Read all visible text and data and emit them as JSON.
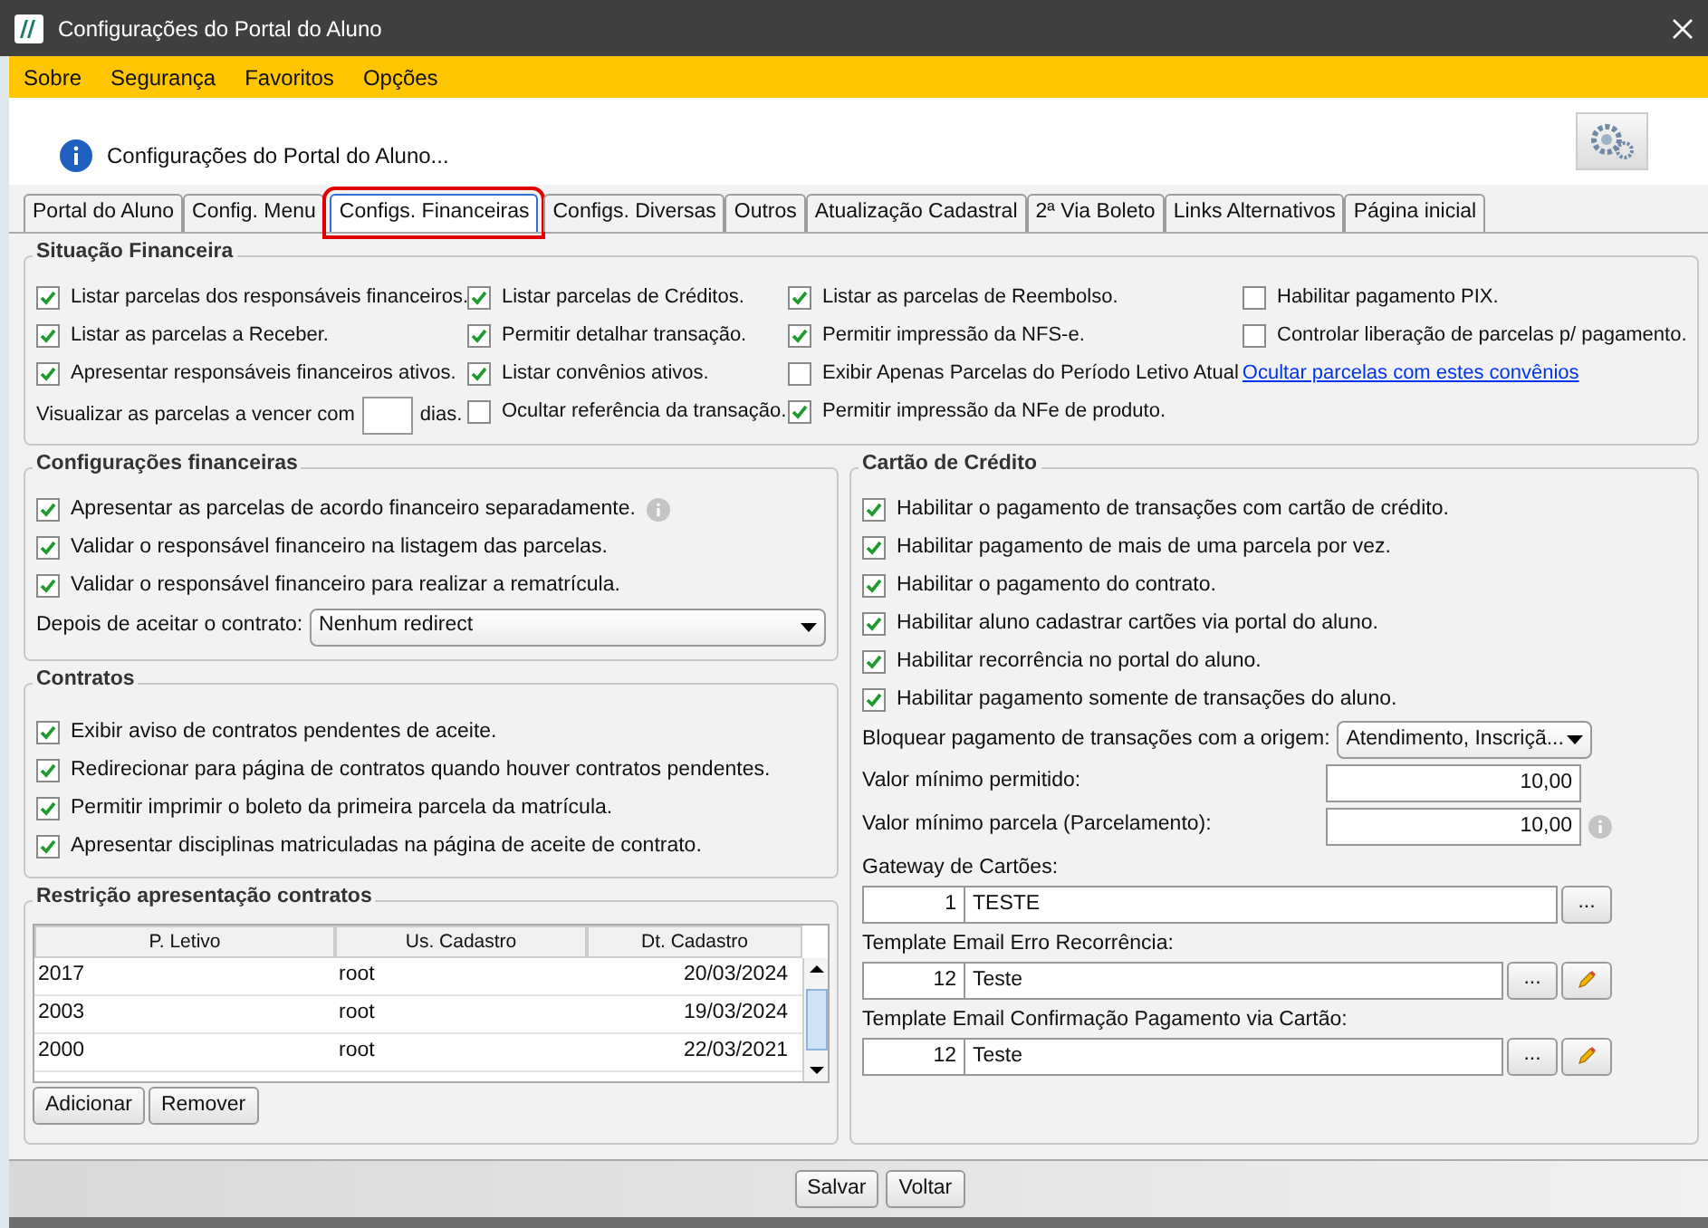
{
  "window": {
    "title": "Configurações do Portal do Aluno"
  },
  "menu": [
    "Sobre",
    "Segurança",
    "Favoritos",
    "Opções"
  ],
  "header": {
    "text": "Configurações do Portal do Aluno..."
  },
  "tabs": [
    {
      "label": "Portal do Aluno",
      "selected": false
    },
    {
      "label": "Config. Menu",
      "selected": false
    },
    {
      "label": "Configs. Financeiras",
      "selected": true,
      "highlighted": true
    },
    {
      "label": "Configs. Diversas",
      "selected": false
    },
    {
      "label": "Outros",
      "selected": false
    },
    {
      "label": "Atualização Cadastral",
      "selected": false
    },
    {
      "label": "2ª Via Boleto",
      "selected": false
    },
    {
      "label": "Links Alternativos",
      "selected": false
    },
    {
      "label": "Página inicial",
      "selected": false
    }
  ],
  "situacao": {
    "title": "Situação Financeira",
    "columns": [
      [
        {
          "kind": "checkbox",
          "label": "Listar parcelas dos responsáveis financeiros.",
          "checked": true
        },
        {
          "kind": "checkbox",
          "label": "Listar as parcelas a Receber.",
          "checked": true
        },
        {
          "kind": "checkbox",
          "label": "Apresentar responsáveis financeiros ativos.",
          "checked": true
        },
        {
          "kind": "days",
          "label": "Visualizar as parcelas a vencer com",
          "suffix": "dias."
        }
      ],
      [
        {
          "kind": "checkbox",
          "label": "Listar parcelas de Créditos.",
          "checked": true
        },
        {
          "kind": "checkbox",
          "label": "Permitir detalhar transação.",
          "checked": true
        },
        {
          "kind": "checkbox",
          "label": "Listar convênios ativos.",
          "checked": true
        },
        {
          "kind": "checkbox",
          "label": "Ocultar referência da transação.",
          "checked": false
        }
      ],
      [
        {
          "kind": "checkbox",
          "label": "Listar as parcelas de Reembolso.",
          "checked": true
        },
        {
          "kind": "checkbox",
          "label": "Permitir impressão da NFS-e.",
          "checked": true
        },
        {
          "kind": "checkbox",
          "label": "Exibir Apenas Parcelas do Período Letivo Atual",
          "checked": false,
          "link": "Ocultar parcelas com estes convênios"
        },
        {
          "kind": "checkbox",
          "label": "Permitir impressão da NFe de produto.",
          "checked": true
        }
      ],
      [
        {
          "kind": "checkbox",
          "label": "Habilitar pagamento PIX.",
          "checked": false
        },
        {
          "kind": "checkbox",
          "label": "Controlar liberação de parcelas p/ pagamento.",
          "checked": false
        }
      ]
    ]
  },
  "config_financeiras": {
    "title": "Configurações financeiras",
    "items": [
      {
        "label": "Apresentar as parcelas de acordo financeiro separadamente.",
        "checked": true,
        "info": true
      },
      {
        "label": "Validar o responsável financeiro na listagem das parcelas.",
        "checked": true,
        "info": false
      },
      {
        "label": "Validar o responsável financeiro para realizar a rematrícula.",
        "checked": true,
        "info": false
      }
    ],
    "redirect": {
      "label": "Depois de aceitar o contrato:",
      "value": "Nenhum redirect"
    }
  },
  "contratos": {
    "title": "Contratos",
    "items": [
      {
        "label": "Exibir aviso de contratos pendentes de aceite.",
        "checked": true
      },
      {
        "label": "Redirecionar para página de contratos quando houver contratos pendentes.",
        "checked": true
      },
      {
        "label": "Permitir imprimir o boleto da primeira parcela da matrícula.",
        "checked": true
      },
      {
        "label": "Apresentar disciplinas matriculadas na página de aceite de contrato.",
        "checked": true
      }
    ]
  },
  "restricao": {
    "title": "Restrição apresentação contratos",
    "columns": [
      "P. Letivo",
      "Us. Cadastro",
      "Dt. Cadastro"
    ],
    "rows": [
      [
        "2017",
        "root",
        "20/03/2024"
      ],
      [
        "2003",
        "root",
        "19/03/2024"
      ],
      [
        "2000",
        "root",
        "22/03/2021"
      ]
    ],
    "buttons": [
      "Adicionar",
      "Remover"
    ]
  },
  "cartao": {
    "title": "Cartão de Crédito",
    "items": [
      {
        "label": "Habilitar o pagamento de transações com cartão de crédito.",
        "checked": true
      },
      {
        "label": "Habilitar pagamento de mais de uma parcela por vez.",
        "checked": true
      },
      {
        "label": "Habilitar o pagamento do contrato.",
        "checked": true
      },
      {
        "label": "Habilitar aluno cadastrar cartões via portal do aluno.",
        "checked": true
      },
      {
        "label": "Habilitar recorrência no portal do aluno.",
        "checked": true
      },
      {
        "label": "Habilitar pagamento somente de transações do aluno.",
        "checked": true
      }
    ],
    "origem": {
      "label": "Bloquear pagamento de transações com a origem:",
      "value": "Atendimento, Inscriçã..."
    },
    "fields": [
      {
        "label": "Valor mínimo permitido:",
        "value": "10,00",
        "info": false
      },
      {
        "label": "Valor mínimo parcela (Parcelamento):",
        "value": "10,00",
        "info": true
      }
    ],
    "lookups": [
      {
        "label": "Gateway de Cartões:",
        "code": "1",
        "name": "TESTE",
        "browse": "...",
        "edit": false
      },
      {
        "label": "Template Email Erro Recorrência:",
        "code": "12",
        "name": "Teste",
        "browse": "...",
        "edit": true
      },
      {
        "label": "Template Email Confirmação Pagamento via Cartão:",
        "code": "12",
        "name": "Teste",
        "browse": "...",
        "edit": true
      }
    ]
  },
  "footer": {
    "buttons": [
      "Salvar",
      "Voltar"
    ]
  }
}
